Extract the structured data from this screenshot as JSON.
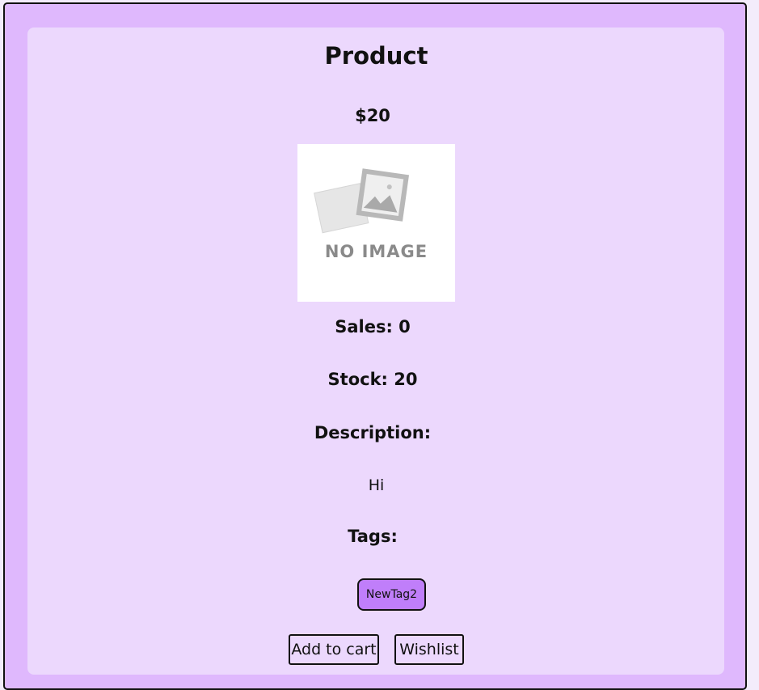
{
  "product": {
    "title": "Product",
    "price": "$20",
    "image_placeholder_text": "NO IMAGE",
    "sales": "Sales: 0",
    "stock": "Stock: 20",
    "description_label": "Description:",
    "description": "Hi",
    "tags_label": "Tags:",
    "tags": [
      "NewTag2"
    ]
  },
  "actions": {
    "add_to_cart": "Add to cart",
    "wishlist": "Wishlist"
  },
  "colors": {
    "outer_background": "#dfb8fd",
    "card_background": "#ecd8fd",
    "tag_background": "#c07efa"
  },
  "icons": {
    "image_placeholder": "no-image-icon"
  }
}
